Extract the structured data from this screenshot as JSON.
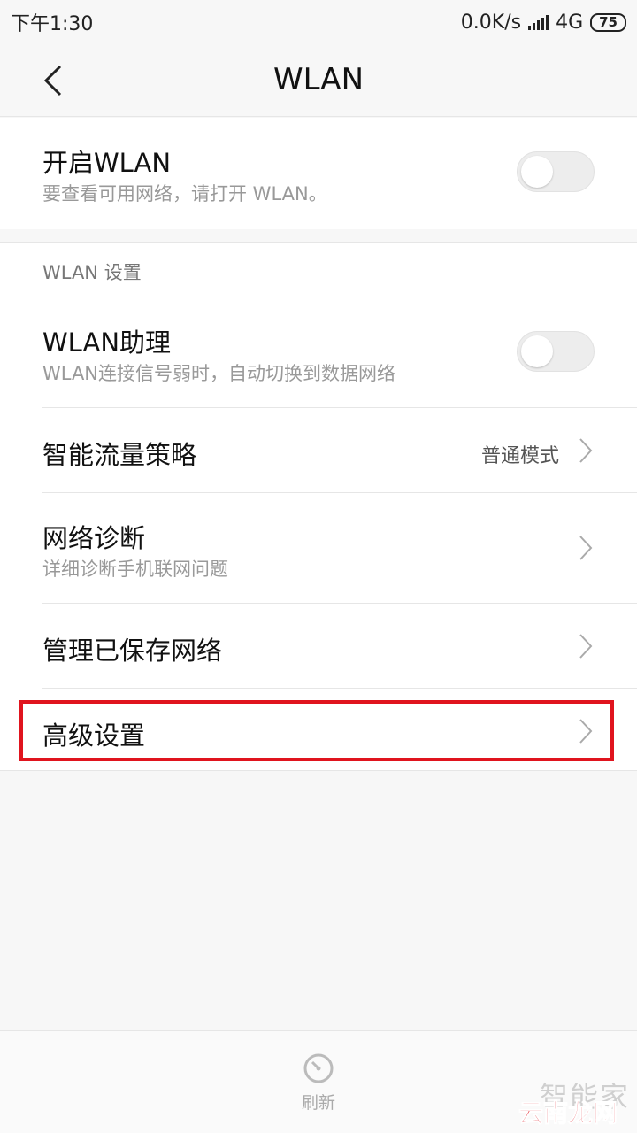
{
  "status_bar": {
    "time": "下午1:30",
    "net_speed": "0.0K/s",
    "network": "4G",
    "battery": "75"
  },
  "header": {
    "title": "WLAN"
  },
  "wlan_toggle": {
    "title": "开启WLAN",
    "subtitle": "要查看可用网络，请打开 WLAN。",
    "on": false
  },
  "settings": {
    "section_label": "WLAN 设置",
    "assistant": {
      "title": "WLAN助理",
      "subtitle": "WLAN连接信号弱时，自动切换到数据网络",
      "on": false
    },
    "traffic": {
      "title": "智能流量策略",
      "value": "普通模式"
    },
    "diagnosis": {
      "title": "网络诊断",
      "subtitle": "详细诊断手机联网问题"
    },
    "saved": {
      "title": "管理已保存网络"
    },
    "advanced": {
      "title": "高级设置"
    }
  },
  "bottom": {
    "refresh_label": "刷新"
  },
  "watermark": {
    "gray": "智能家",
    "red": "云南龙网"
  },
  "colors": {
    "highlight": "#e0141e",
    "toggle_off": "#ededed"
  }
}
